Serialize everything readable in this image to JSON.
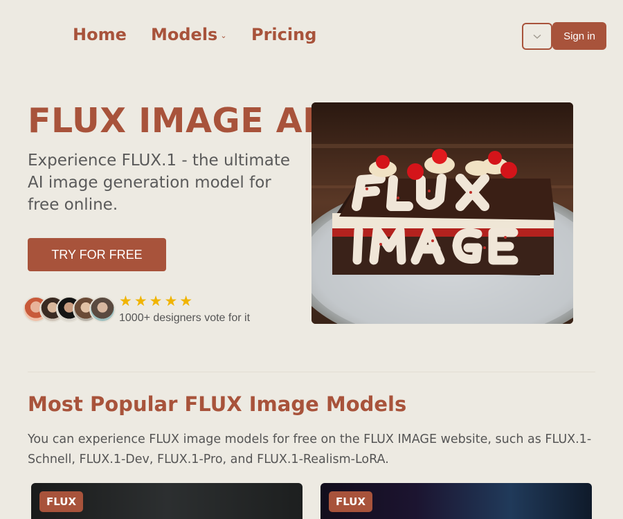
{
  "nav": {
    "home": "Home",
    "models": "Models",
    "pricing": "Pricing",
    "sign_in": "Sign in"
  },
  "hero": {
    "title": "FLUX IMAGE AI",
    "subtitle": "Experience FLUX.1 - the ultimate AI image generation model for free online.",
    "cta": "TRY FOR FREE",
    "stars": "★★★★★",
    "rating_stars": 5,
    "vote_text": "1000+ designers vote for it",
    "image_alt": "FLUX IMAGE cake"
  },
  "popular": {
    "title": "Most Popular FLUX Image Models",
    "description": "You can experience FLUX image models for free on the FLUX IMAGE website, such as FLUX.1-Schnell, FLUX.1-Dev, FLUX.1-Pro, and FLUX.1-Realism-LoRA.",
    "cards": [
      {
        "badge": "FLUX"
      },
      {
        "badge": "FLUX"
      }
    ]
  },
  "colors": {
    "accent": "#a8533b",
    "background": "#edeae2",
    "star": "#f0b400"
  },
  "icons": {
    "language_dropdown": "chevron-down-icon",
    "models_dropdown": "chevron-down-icon"
  }
}
